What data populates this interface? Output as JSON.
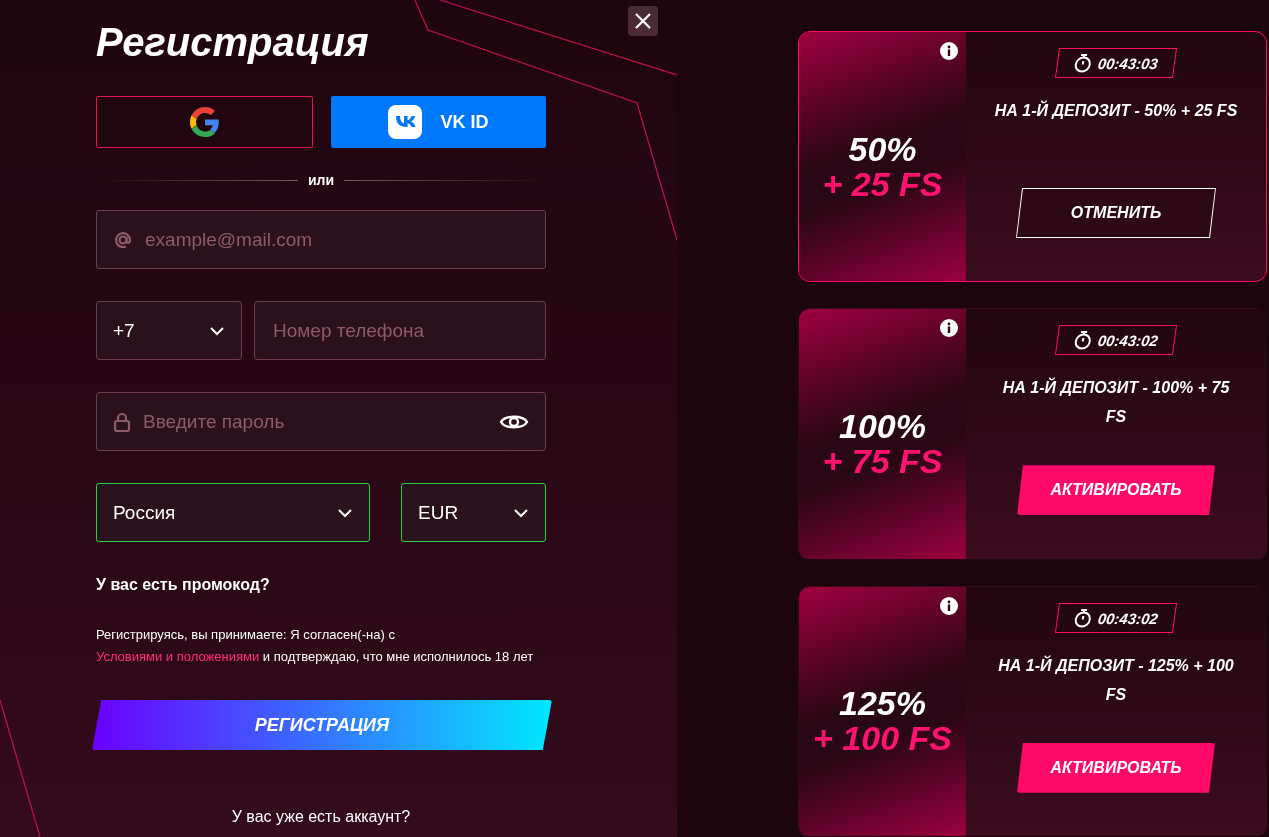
{
  "title": "Регистрация",
  "social": {
    "vk_label": "VK ID"
  },
  "divider_text": "или",
  "email": {
    "placeholder": "example@mail.com"
  },
  "phone": {
    "code": "+7",
    "placeholder": "Номер телефона"
  },
  "password": {
    "placeholder": "Введите пароль"
  },
  "country": {
    "value": "Россия",
    "valid": true
  },
  "currency": {
    "value": "EUR",
    "valid": true
  },
  "promo_link": "У вас есть промокод?",
  "terms": {
    "before": "Регистрируясь, вы принимаете: Я согласен(-на) с ",
    "link": "Условиями и положениями",
    "after": " и подтверждаю, что мне исполнилось 18 лет"
  },
  "register_button": "РЕГИСТРАЦИЯ",
  "login_prompt": "У вас уже есть аккаунт?",
  "bonuses": [
    {
      "percent": "50%",
      "fs": "+ 25 FS",
      "timer": "00:43:03",
      "description": "НА 1-Й ДЕПОЗИТ - 50% + 25 FS",
      "button": "ОТМЕНИТЬ",
      "selected": true
    },
    {
      "percent": "100%",
      "fs": "+ 75 FS",
      "timer": "00:43:02",
      "description": "НА 1-Й ДЕПОЗИТ - 100% + 75 FS",
      "button": "АКТИВИРОВАТЬ",
      "selected": false
    },
    {
      "percent": "125%",
      "fs": "+ 100 FS",
      "timer": "00:43:02",
      "description": "НА 1-Й ДЕПОЗИТ - 125% + 100 FS",
      "button": "АКТИВИРОВАТЬ",
      "selected": false
    }
  ]
}
